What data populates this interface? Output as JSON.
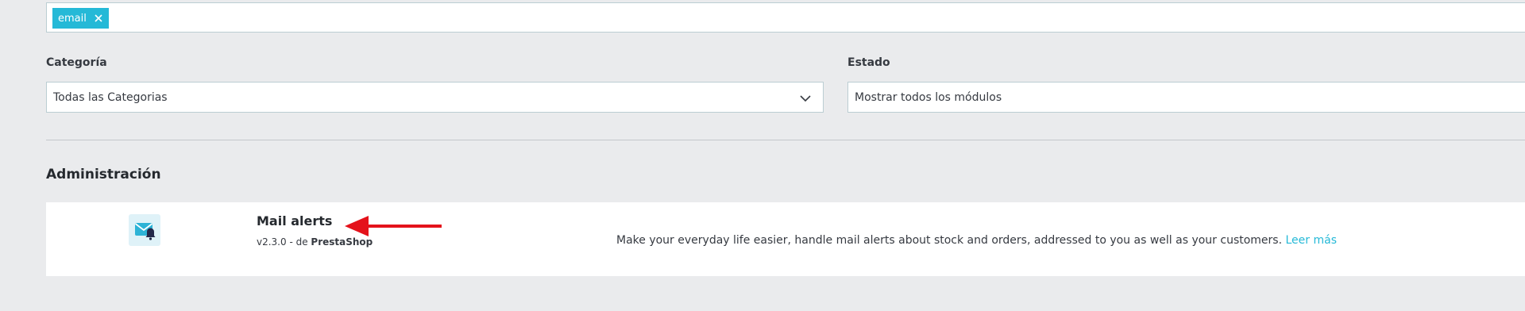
{
  "search": {
    "tag_label": "email"
  },
  "filters": {
    "category_label": "Categoría",
    "category_value": "Todas las Categorias",
    "status_label": "Estado",
    "status_value": "Mostrar todos los módulos"
  },
  "section": {
    "title": "Administración"
  },
  "module": {
    "name": "Mail alerts",
    "version": "v2.3.0 - de",
    "author": "PrestaShop",
    "description": "Make your everyday life easier, handle mail alerts about stock and orders, addressed to you as well as your customers.",
    "read_more": "Leer más",
    "icon": "mail-bell-icon"
  },
  "colors": {
    "accent": "#25b9d7",
    "background": "#eaebed",
    "annotation": "#e4121b"
  }
}
